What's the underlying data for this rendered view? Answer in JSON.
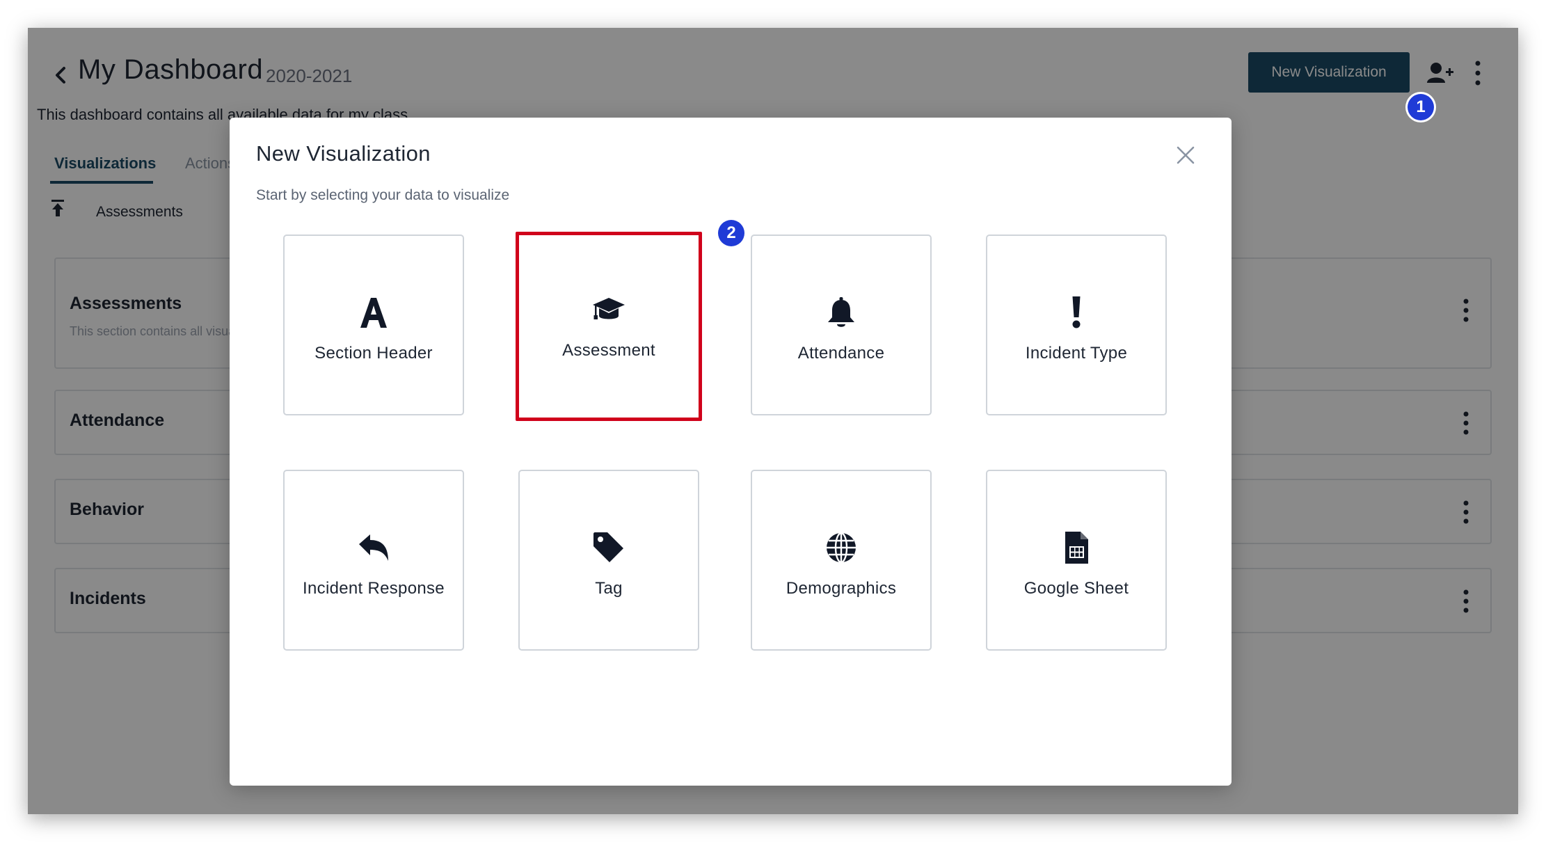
{
  "header": {
    "title": "My Dashboard",
    "year": "2020-2021",
    "description": "This dashboard contains all available data for my class",
    "new_visualization_label": "New Visualization"
  },
  "tabs": [
    {
      "label": "Visualizations",
      "active": true
    },
    {
      "label": "Actions",
      "active": false
    }
  ],
  "filters": [
    {
      "label": "Assessments"
    }
  ],
  "sections": [
    {
      "title": "Assessments",
      "description": "This section contains all visualizations"
    },
    {
      "title": "Attendance"
    },
    {
      "title": "Behavior"
    },
    {
      "title": "Incidents"
    }
  ],
  "badges": [
    {
      "label": "1"
    },
    {
      "label": "2"
    }
  ],
  "modal": {
    "title": "New Visualization",
    "subtitle": "Start by selecting your data to visualize",
    "options": [
      {
        "label": "Section Header",
        "icon": "letter-a-icon"
      },
      {
        "label": "Assessment",
        "icon": "graduation-cap-icon",
        "selected": true
      },
      {
        "label": "Attendance",
        "icon": "bell-icon"
      },
      {
        "label": "Incident Type",
        "icon": "exclamation-icon"
      },
      {
        "label": "Incident Response",
        "icon": "reply-arrow-icon"
      },
      {
        "label": "Tag",
        "icon": "tag-icon"
      },
      {
        "label": "Demographics",
        "icon": "globe-icon"
      },
      {
        "label": "Google Sheet",
        "icon": "spreadsheet-icon"
      }
    ]
  },
  "colors": {
    "primary": "#1a4a66",
    "highlight": "#d0021b",
    "badge": "#1f3bd6",
    "overlay": "rgba(0,0,0,0.46)"
  }
}
